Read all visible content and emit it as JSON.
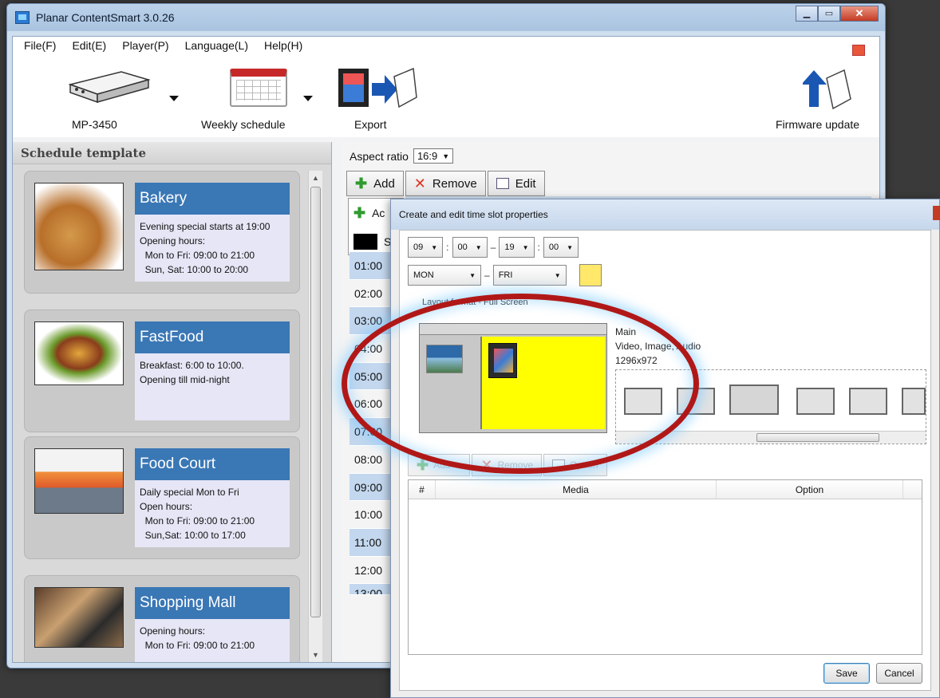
{
  "window": {
    "title": "Planar ContentSmart 3.0.26"
  },
  "menu": [
    "File(F)",
    "Edit(E)",
    "Player(P)",
    "Language(L)",
    "Help(H)"
  ],
  "toolbar": {
    "player_label": "MP-3450",
    "schedule_label": "Weekly schedule",
    "export_label": "Export",
    "firmware_label": "Firmware update"
  },
  "left_panel": {
    "header": "Schedule template",
    "cards": [
      {
        "name": "Bakery",
        "desc": "Evening special starts at 19:00\nOpening hours:\n  Mon to Fri: 09:00 to 21:00\n  Sun, Sat: 10:00 to 20:00"
      },
      {
        "name": "FastFood",
        "desc": "Breakfast: 6:00 to 10:00.\nOpening till mid-night"
      },
      {
        "name": "Food Court",
        "desc": "Daily special Mon to Fri\nOpen hours:\n  Mon to Fri: 09:00 to 21:00\n  Sun,Sat: 10:00 to 17:00"
      },
      {
        "name": "Shopping Mall",
        "desc": "Opening hours:\n  Mon to Fri: 09:00 to 21:00"
      }
    ]
  },
  "schedule": {
    "aspect_label": "Aspect ratio",
    "aspect_value": "16:9",
    "add_label": "Add",
    "remove_label": "Remove",
    "edit_label": "Edit",
    "popup_add": "Ac",
    "popup_sc": "Sc",
    "times": [
      "01:00",
      "02:00",
      "03:00",
      "04:00",
      "05:00",
      "06:00",
      "07:00",
      "08:00",
      "09:00",
      "10:00",
      "11:00",
      "12:00",
      "13:00"
    ]
  },
  "dialog": {
    "title": "Create and edit time slot properties",
    "start_hour": "09",
    "start_min": "00",
    "end_hour": "19",
    "end_min": "00",
    "day_from": "MON",
    "day_to": "FRI",
    "slot_color": "#ffe86a",
    "layout_label": "Layout format - Full Screen",
    "main_label": "Main",
    "main_types": "Video, Image, Audio",
    "main_res": "1296x972",
    "add_label": "Add",
    "remove_label": "Remove",
    "option_label": "Option",
    "col_num": "#",
    "col_media": "Media",
    "col_option": "Option",
    "save_label": "Save",
    "cancel_label": "Cancel"
  },
  "colors": {
    "accent": "#3a77b5",
    "highlight": "#b01818"
  }
}
